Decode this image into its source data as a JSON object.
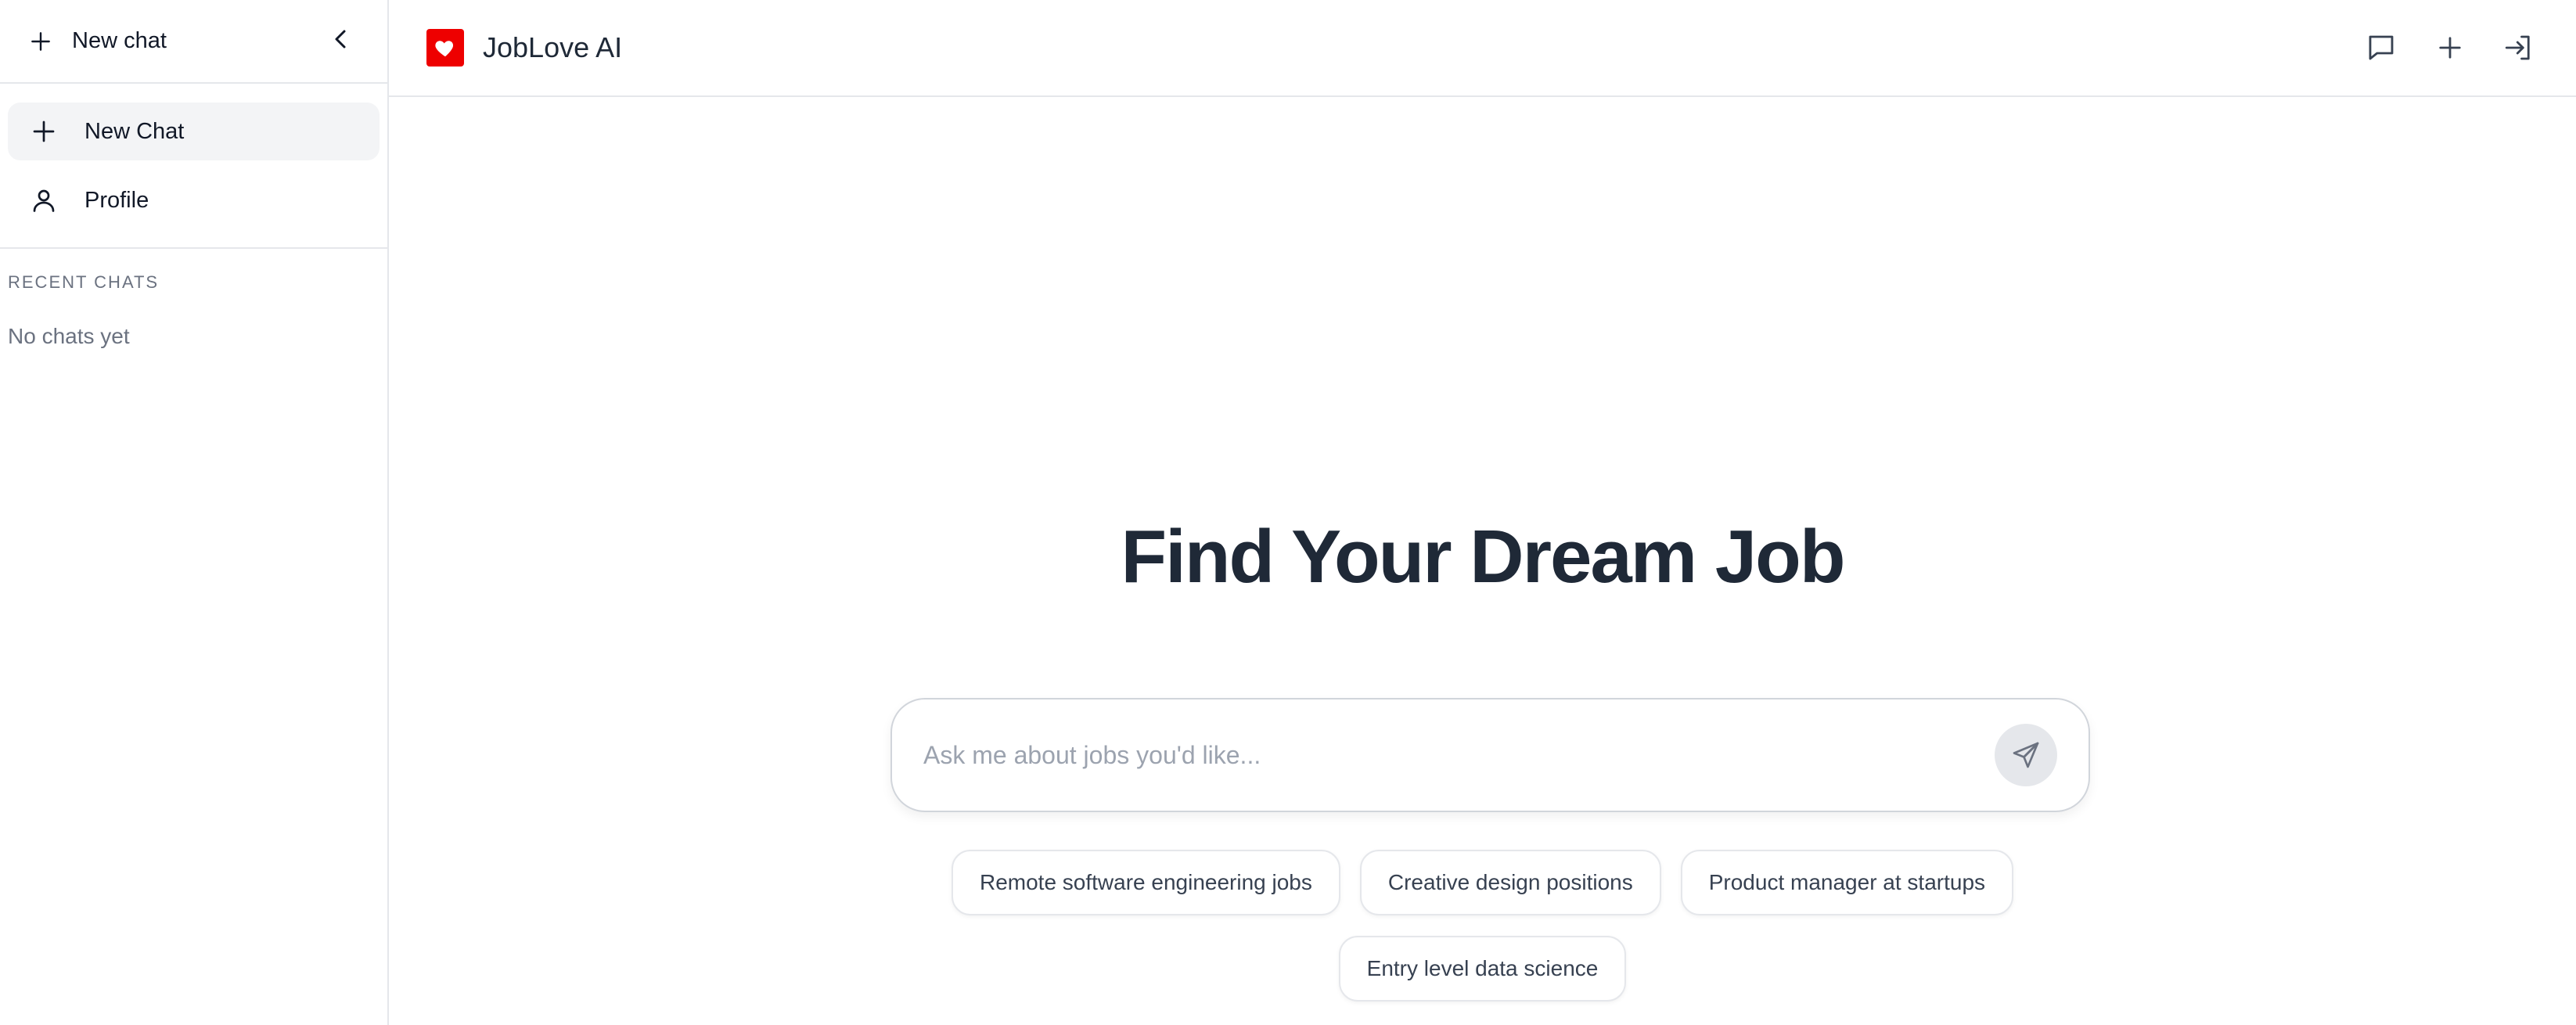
{
  "sidebar": {
    "top_label": "New chat",
    "nav": [
      {
        "label": "New Chat",
        "icon": "plus-icon"
      },
      {
        "label": "Profile",
        "icon": "user-icon"
      }
    ],
    "recent_heading": "RECENT CHATS",
    "empty_text": "No chats yet"
  },
  "header": {
    "brand": "JobLove AI",
    "logo_color": "#ee0000",
    "actions": [
      "chat-icon",
      "plus-icon",
      "sign-in-icon"
    ]
  },
  "main": {
    "hero_title": "Find Your Dream Job",
    "search_placeholder": "Ask me about jobs you'd like...",
    "suggestions": [
      "Remote software engineering jobs",
      "Creative design positions",
      "Product manager at startups",
      "Entry level data science"
    ]
  }
}
